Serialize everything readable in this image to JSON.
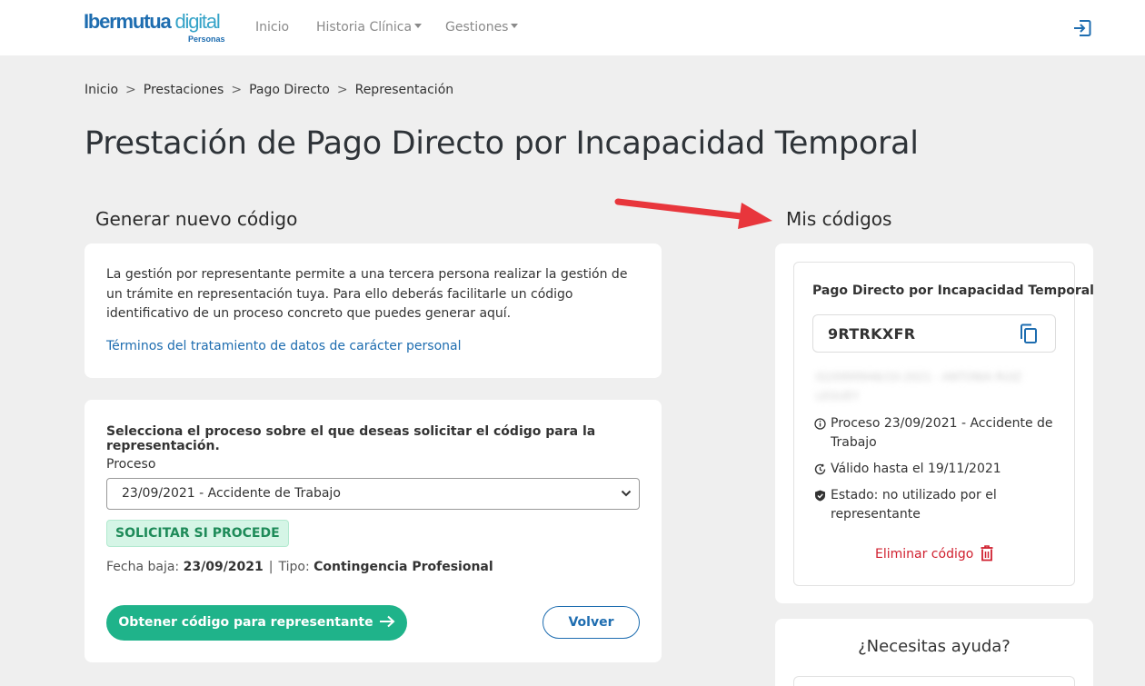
{
  "header": {
    "logo_main_part1": "Ibermutua",
    "logo_main_part2": " digital",
    "logo_sub": "Personas",
    "nav": [
      {
        "label": "Inicio"
      },
      {
        "label": "Historia Clínica"
      },
      {
        "label": "Gestiones"
      }
    ]
  },
  "breadcrumb": [
    "Inicio",
    "Prestaciones",
    "Pago Directo",
    "Representación"
  ],
  "page_title": "Prestación de Pago Directo por Incapacidad Temporal",
  "generate": {
    "title": "Generar nuevo código",
    "info": "La gestión por representante permite a una tercera persona realizar la gestión de un trámite en representación tuya. Para ello deberás facilitarle un código identificativo de un proceso concreto que puedes generar aquí.",
    "terms_link": "Términos del tratamiento de datos de carácter personal",
    "select_prompt": "Selecciona el proceso sobre el que deseas solicitar el código para la representación.",
    "proceso_label": "Proceso",
    "proceso_value": "23/09/2021 - Accidente de Trabajo",
    "badge": "SOLICITAR SI PROCEDE",
    "fecha_label": "Fecha baja:",
    "fecha_value": "23/09/2021",
    "tipo_label": "Tipo:",
    "tipo_value": "Contingencia Profesional",
    "primary_button": "Obtener código para representante",
    "back_button": "Volver"
  },
  "codes": {
    "title": "Mis códigos",
    "card_title": "Pago Directo por Incapacidad Temporal",
    "code": "9RTRKXFR",
    "blurred_text": "02/0999946/10-2021 - ANTONIA RUIZ LEGUEY",
    "proceso": "Proceso 23/09/2021 - Accidente de Trabajo",
    "valido": "Válido hasta el 19/11/2021",
    "estado": "Estado: no utilizado por el representante",
    "delete": "Eliminar código"
  },
  "help": {
    "title": "¿Necesitas ayuda?"
  },
  "colors": {
    "primary_green": "#1fb38a",
    "brand_blue": "#1e6db0",
    "danger_red": "#d0202f",
    "annotation_arrow": "#e8363c"
  }
}
